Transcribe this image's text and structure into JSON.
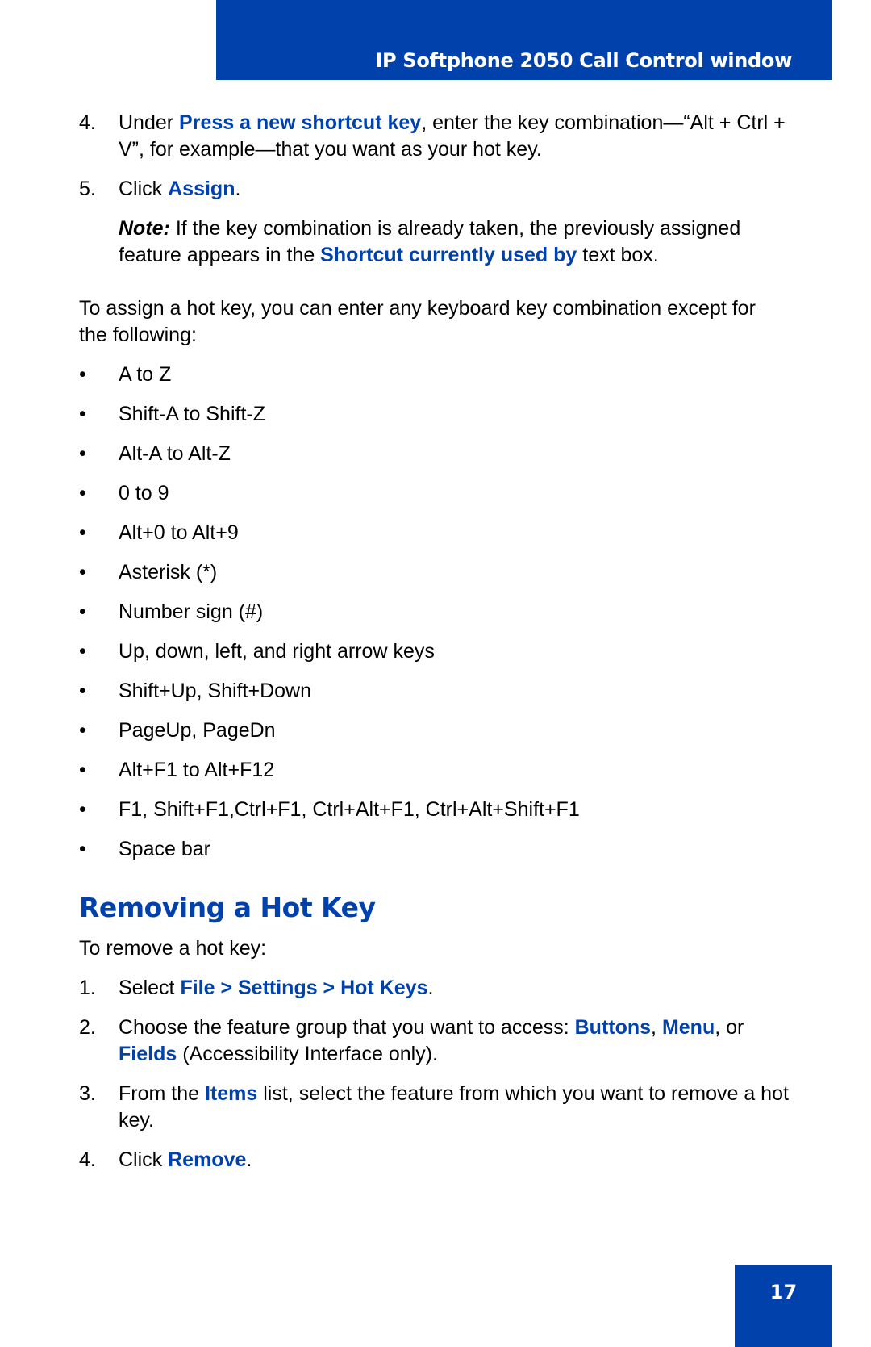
{
  "header": {
    "title": "IP Softphone 2050 Call Control window"
  },
  "assign_steps": [
    {
      "num": "4.",
      "parts": [
        {
          "t": "Under ",
          "b": false
        },
        {
          "t": "Press a new shortcut key",
          "b": true
        },
        {
          "t": ", enter the key combination—“Alt + Ctrl + V”, for example—that you want as your hot key.",
          "b": false
        }
      ]
    },
    {
      "num": "5.",
      "parts": [
        {
          "t": "Click ",
          "b": false
        },
        {
          "t": "Assign",
          "b": true
        },
        {
          "t": ".",
          "b": false
        }
      ]
    }
  ],
  "note": {
    "label": "Note:",
    "parts": [
      {
        "t": " If the key combination is already taken, the previously assigned feature appears in the ",
        "b": false
      },
      {
        "t": "Shortcut currently used by",
        "b": true
      },
      {
        "t": " text box.",
        "b": false
      }
    ]
  },
  "intro_paragraph": "To assign a hot key, you can enter any keyboard key combination except for the following:",
  "bullet_char": "•",
  "exceptions": [
    "A to Z",
    "Shift-A to Shift-Z",
    "Alt-A to Alt-Z",
    "0 to 9",
    "Alt+0 to Alt+9",
    "Asterisk (*)",
    "Number sign (#)",
    "Up, down, left, and right arrow keys",
    "Shift+Up, Shift+Down",
    "PageUp, PageDn",
    "Alt+F1 to Alt+F12",
    "F1, Shift+F1,Ctrl+F1, Ctrl+Alt+F1, Ctrl+Alt+Shift+F1",
    "Space bar"
  ],
  "section": {
    "heading": "Removing a Hot Key",
    "intro": "To remove a hot key:",
    "steps": [
      {
        "num": "1.",
        "parts": [
          {
            "t": "Select ",
            "b": false
          },
          {
            "t": "File > Settings > Hot Keys",
            "b": true
          },
          {
            "t": ".",
            "b": false
          }
        ]
      },
      {
        "num": "2.",
        "parts": [
          {
            "t": "Choose the feature group that you want to access: ",
            "b": false
          },
          {
            "t": "Buttons",
            "b": true
          },
          {
            "t": ", ",
            "b": false
          },
          {
            "t": "Menu",
            "b": true
          },
          {
            "t": ", or ",
            "b": false
          },
          {
            "t": "Fields",
            "b": true
          },
          {
            "t": " (Accessibility Interface only).",
            "b": false
          }
        ]
      },
      {
        "num": "3.",
        "parts": [
          {
            "t": "From the ",
            "b": false
          },
          {
            "t": "Items",
            "b": true
          },
          {
            "t": " list, select the feature from which you want to remove a hot key.",
            "b": false
          }
        ]
      },
      {
        "num": "4.",
        "parts": [
          {
            "t": "Click ",
            "b": false
          },
          {
            "t": "Remove",
            "b": true
          },
          {
            "t": ".",
            "b": false
          }
        ]
      }
    ]
  },
  "page_number": "17",
  "colors": {
    "brand_blue": "#0041ab",
    "text": "#000000",
    "background": "#ffffff"
  }
}
